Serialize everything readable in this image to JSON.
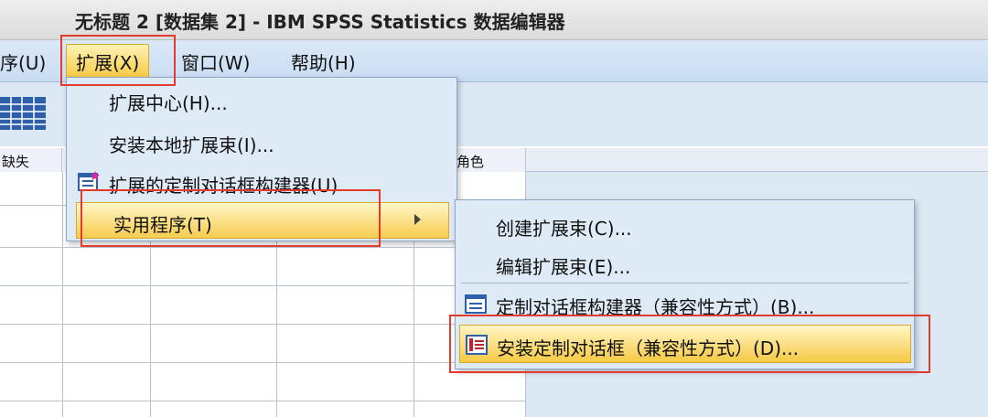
{
  "window": {
    "title": "无标题 2 [数据集 2] - IBM SPSS Statistics 数据编辑器"
  },
  "menubar": {
    "items": [
      {
        "label": "序(U)"
      },
      {
        "label": "扩展(X)",
        "active": true
      },
      {
        "label": "窗口(W)"
      },
      {
        "label": "帮助(H)"
      }
    ]
  },
  "grid": {
    "headers": [
      "缺失",
      "角色"
    ]
  },
  "extension_menu": {
    "items": [
      {
        "label": "扩展中心(H)..."
      },
      {
        "label": "安装本地扩展束(I)..."
      },
      {
        "label": "扩展的定制对话框构建器(U)",
        "icon": "dialog-builder-icon"
      },
      {
        "label": "实用程序(T)",
        "submenu": true,
        "highlighted": true
      }
    ]
  },
  "utilities_submenu": {
    "items": [
      {
        "label": "创建扩展束(C)..."
      },
      {
        "label": "编辑扩展束(E)..."
      },
      {
        "label": "定制对话框构建器（兼容性方式）(B)...",
        "icon": "dialog-builder-icon"
      },
      {
        "label": "安装定制对话框（兼容性方式）(D)...",
        "icon": "install-dialog-icon",
        "highlighted": true
      }
    ]
  },
  "colors": {
    "highlight": "#f6c943",
    "menu_bg": "#dfeaf7",
    "annotation": "#e53a2f"
  }
}
